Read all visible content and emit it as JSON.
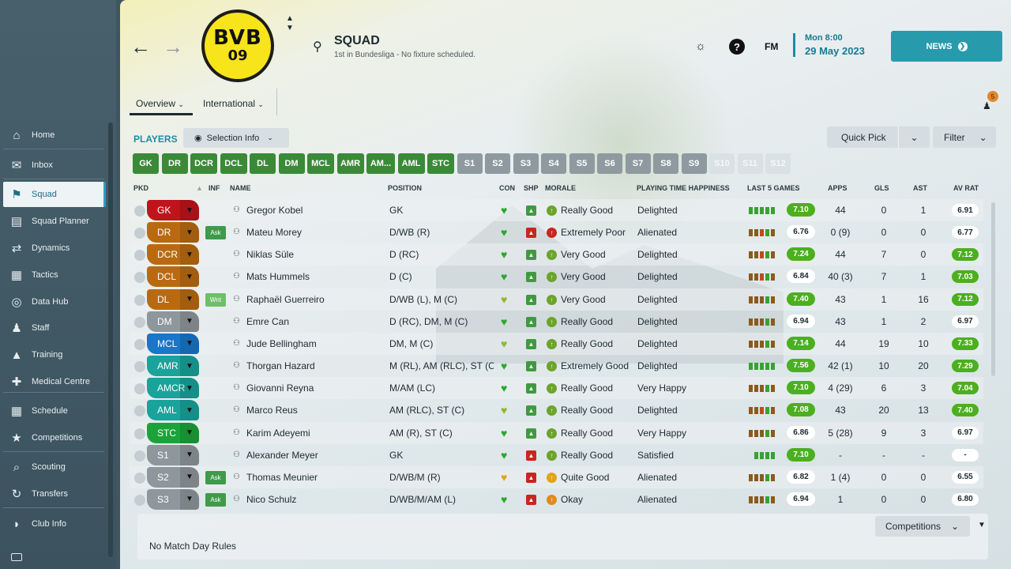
{
  "sidebar": {
    "items": [
      {
        "label": "Home",
        "icon": "home-icon"
      },
      {
        "label": "Inbox",
        "icon": "inbox-icon"
      },
      {
        "label": "Squad",
        "icon": "shirt-icon"
      },
      {
        "label": "Squad Planner",
        "icon": "clipboard-icon"
      },
      {
        "label": "Dynamics",
        "icon": "dynamics-icon"
      },
      {
        "label": "Tactics",
        "icon": "tactics-icon"
      },
      {
        "label": "Data Hub",
        "icon": "data-hub-icon"
      },
      {
        "label": "Staff",
        "icon": "staff-icon"
      },
      {
        "label": "Training",
        "icon": "training-icon"
      },
      {
        "label": "Medical Centre",
        "icon": "medical-icon"
      },
      {
        "label": "Schedule",
        "icon": "calendar-icon"
      },
      {
        "label": "Competitions",
        "icon": "trophy-icon"
      },
      {
        "label": "Scouting",
        "icon": "search-icon"
      },
      {
        "label": "Transfers",
        "icon": "transfers-icon"
      },
      {
        "label": "Club Info",
        "icon": "shield-icon"
      }
    ]
  },
  "header": {
    "logo_line1": "BVB",
    "logo_line2": "09",
    "title": "SQUAD",
    "subtitle": "1st in Bundesliga - No fixture scheduled.",
    "top_icon_fm": "FM",
    "date_line1": "Mon 8:00",
    "date_line2": "29 May 2023",
    "news_label": "NEWS",
    "notification_count": "5"
  },
  "tabs": {
    "overview": "Overview",
    "international": "International"
  },
  "toolbar": {
    "players_label": "PLAYERS",
    "selection_info": "Selection Info",
    "quick_pick": "Quick Pick",
    "filter": "Filter"
  },
  "position_buttons": [
    "GK",
    "DR",
    "DCR",
    "DCL",
    "DL",
    "DM",
    "MCL",
    "AMR",
    "AM...",
    "AML",
    "STC",
    "S1",
    "S2",
    "S3",
    "S4",
    "S5",
    "S6",
    "S7",
    "S8",
    "S9",
    "S10",
    "S11",
    "S12"
  ],
  "columns": {
    "pkd": "PKD",
    "inf": "INF",
    "name": "NAME",
    "position": "POSITION",
    "con": "CON",
    "shp": "SHP",
    "morale": "MORALE",
    "happiness": "PLAYING TIME HAPPINESS",
    "last5": "LAST 5 GAMES",
    "apps": "APPS",
    "gls": "GLS",
    "ast": "AST",
    "avrat": "AV RAT"
  },
  "players": [
    {
      "slot": "GK",
      "slot_color": "#c0141c",
      "inf": "",
      "name": "Gregor Kobel",
      "position": "GK",
      "morale": "Really Good",
      "morale_color": "#6ca42a",
      "happiness": "Delighted",
      "last5": "7.10",
      "last5_color": "#4caf1f",
      "apps": "44",
      "gls": "0",
      "ast": "1",
      "avrat": "6.91",
      "avrat_color": "#ffffff"
    },
    {
      "slot": "DR",
      "slot_color": "#b96a10",
      "inf": "Ask",
      "name": "Mateu Morey",
      "position": "D/WB (R)",
      "morale": "Extremely Poor",
      "morale_color": "#c8261e",
      "happiness": "Alienated",
      "last5": "6.76",
      "last5_color": "#ffffff",
      "apps": "0 (9)",
      "gls": "0",
      "ast": "0",
      "avrat": "6.77",
      "avrat_color": "#ffffff"
    },
    {
      "slot": "DCR",
      "slot_color": "#b96a10",
      "inf": "",
      "name": "Niklas Süle",
      "position": "D (RC)",
      "morale": "Very Good",
      "morale_color": "#6ca42a",
      "happiness": "Delighted",
      "last5": "7.24",
      "last5_color": "#4caf1f",
      "apps": "44",
      "gls": "7",
      "ast": "0",
      "avrat": "7.12",
      "avrat_color": "#4caf1f"
    },
    {
      "slot": "DCL",
      "slot_color": "#b96a10",
      "inf": "",
      "name": "Mats Hummels",
      "position": "D (C)",
      "morale": "Very Good",
      "morale_color": "#6ca42a",
      "happiness": "Delighted",
      "last5": "6.84",
      "last5_color": "#ffffff",
      "apps": "40 (3)",
      "gls": "7",
      "ast": "1",
      "avrat": "7.03",
      "avrat_color": "#4caf1f"
    },
    {
      "slot": "DL",
      "slot_color": "#b96a10",
      "inf": "Wnt",
      "name": "Raphaël Guerreiro",
      "position": "D/WB (L), M (C)",
      "morale": "Very Good",
      "morale_color": "#6ca42a",
      "happiness": "Delighted",
      "last5": "7.40",
      "last5_color": "#4caf1f",
      "apps": "43",
      "gls": "1",
      "ast": "16",
      "avrat": "7.12",
      "avrat_color": "#4caf1f"
    },
    {
      "slot": "DM",
      "slot_color": "#8e979b",
      "inf": "",
      "name": "Emre Can",
      "position": "D (RC), DM, M (C)",
      "morale": "Really Good",
      "morale_color": "#6ca42a",
      "happiness": "Delighted",
      "last5": "6.94",
      "last5_color": "#ffffff",
      "apps": "43",
      "gls": "1",
      "ast": "2",
      "avrat": "6.97",
      "avrat_color": "#ffffff"
    },
    {
      "slot": "MCL",
      "slot_color": "#1976c8",
      "inf": "",
      "name": "Jude Bellingham",
      "position": "DM, M (C)",
      "morale": "Really Good",
      "morale_color": "#6ca42a",
      "happiness": "Delighted",
      "last5": "7.14",
      "last5_color": "#4caf1f",
      "apps": "44",
      "gls": "19",
      "ast": "10",
      "avrat": "7.33",
      "avrat_color": "#4caf1f"
    },
    {
      "slot": "AMR",
      "slot_color": "#19a39a",
      "inf": "",
      "name": "Thorgan Hazard",
      "position": "M (RL), AM (RLC), ST (C)",
      "morale": "Extremely Good",
      "morale_color": "#6ca42a",
      "happiness": "Delighted",
      "last5": "7.56",
      "last5_color": "#4caf1f",
      "apps": "42 (1)",
      "gls": "10",
      "ast": "20",
      "avrat": "7.29",
      "avrat_color": "#4caf1f"
    },
    {
      "slot": "AMCR",
      "slot_color": "#19a39a",
      "inf": "",
      "name": "Giovanni Reyna",
      "position": "M/AM (LC)",
      "morale": "Really Good",
      "morale_color": "#6ca42a",
      "happiness": "Very Happy",
      "last5": "7.10",
      "last5_color": "#4caf1f",
      "apps": "4 (29)",
      "gls": "6",
      "ast": "3",
      "avrat": "7.04",
      "avrat_color": "#4caf1f"
    },
    {
      "slot": "AML",
      "slot_color": "#19a39a",
      "inf": "",
      "name": "Marco Reus",
      "position": "AM (RLC), ST (C)",
      "morale": "Really Good",
      "morale_color": "#6ca42a",
      "happiness": "Delighted",
      "last5": "7.08",
      "last5_color": "#4caf1f",
      "apps": "43",
      "gls": "20",
      "ast": "13",
      "avrat": "7.40",
      "avrat_color": "#4caf1f"
    },
    {
      "slot": "STC",
      "slot_color": "#1ba33a",
      "inf": "",
      "name": "Karim Adeyemi",
      "position": "AM (R), ST (C)",
      "morale": "Really Good",
      "morale_color": "#6ca42a",
      "happiness": "Very Happy",
      "last5": "6.86",
      "last5_color": "#ffffff",
      "apps": "5 (28)",
      "gls": "9",
      "ast": "3",
      "avrat": "6.97",
      "avrat_color": "#ffffff"
    },
    {
      "slot": "S1",
      "slot_color": "#8e979b",
      "inf": "",
      "name": "Alexander Meyer",
      "position": "GK",
      "morale": "Really Good",
      "morale_color": "#6ca42a",
      "happiness": "Satisfied",
      "last5": "7.10",
      "last5_color": "#4caf1f",
      "apps": "-",
      "gls": "-",
      "ast": "-",
      "avrat": "-",
      "avrat_color": "#ffffff"
    },
    {
      "slot": "S2",
      "slot_color": "#8e979b",
      "inf": "Ask",
      "name": "Thomas Meunier",
      "position": "D/WB/M (R)",
      "morale": "Quite Good",
      "morale_color": "#e2a21a",
      "happiness": "Alienated",
      "last5": "6.82",
      "last5_color": "#ffffff",
      "apps": "1 (4)",
      "gls": "0",
      "ast": "0",
      "avrat": "6.55",
      "avrat_color": "#ffffff"
    },
    {
      "slot": "S3",
      "slot_color": "#8e979b",
      "inf": "Ask",
      "name": "Nico Schulz",
      "position": "D/WB/M/AM (L)",
      "morale": "Okay",
      "morale_color": "#e28a1a",
      "happiness": "Alienated",
      "last5": "6.94",
      "last5_color": "#ffffff",
      "apps": "1",
      "gls": "0",
      "ast": "0",
      "avrat": "6.80",
      "avrat_color": "#ffffff"
    }
  ],
  "footer": {
    "competitions": "Competitions",
    "no_match_day_rules": "No Match Day Rules"
  }
}
